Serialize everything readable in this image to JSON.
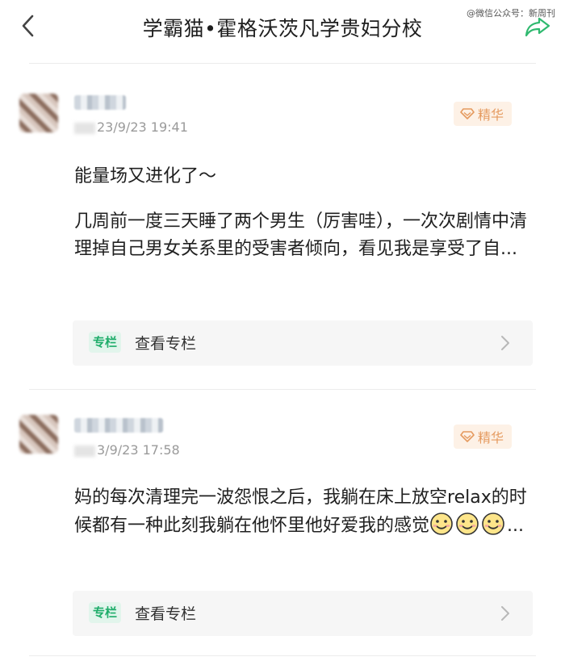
{
  "header": {
    "title": "学霸猫•霍格沃茨凡学贵妇分校",
    "watermark": "@微信公众号：新周刊",
    "back_icon": "chevron-left-icon",
    "share_icon": "share-arrow-icon"
  },
  "posts": [
    {
      "date": "23/9/23 19:41",
      "badge": "精华",
      "paragraph1": "能量场又进化了～",
      "paragraph2": "几周前一度三天睡了两个男生（厉害哇），一次次剧情中清理掉自己男女关系里的受害者倾向，看见我是享受了自...",
      "column_tag": "专栏",
      "column_label": "查看专栏"
    },
    {
      "date": "3/9/23 17:58",
      "badge": "精华",
      "paragraph1": "妈的每次清理完一波怨恨之后，我躺在床上放空relax的时候都有一种此刻我躺在他怀里他好爱我的感觉",
      "emoji": "smile-emoji-icon",
      "ellipsis": "...",
      "column_tag": "专栏",
      "column_label": "查看专栏"
    }
  ],
  "colors": {
    "badge_text": "#e59a5f",
    "badge_bg": "#fdf1e6",
    "column_tag_text": "#1fad6a",
    "column_tag_bg": "#e2f5ec",
    "share_icon": "#2fb96f"
  }
}
